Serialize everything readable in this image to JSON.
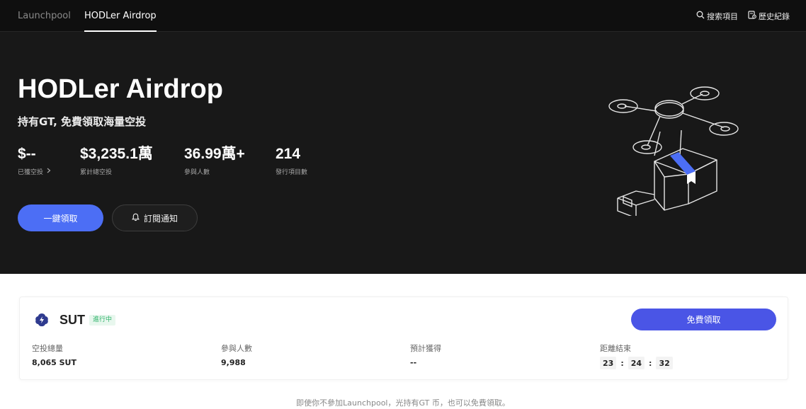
{
  "nav": {
    "tabs": [
      {
        "label": "Launchpool",
        "active": false
      },
      {
        "label": "HODLer Airdrop",
        "active": true
      }
    ],
    "search_label": "搜索項目",
    "history_label": "歷史紀錄",
    "search_icon": "search-icon",
    "history_icon": "history-icon"
  },
  "hero": {
    "title": "HODLer Airdrop",
    "subtitle": "持有GT, 免費領取海量空投",
    "stats": [
      {
        "value": "$--",
        "label": "已獲空投"
      },
      {
        "value": "$3,235.1萬",
        "label": "累計總空投"
      },
      {
        "value": "36.99萬+",
        "label": "參與人數"
      },
      {
        "value": "214",
        "label": "發行項目數"
      }
    ],
    "claim_all_label": "一鍵領取",
    "subscribe_label": "訂閱通知",
    "illustration_icon": "drone-package-illustration"
  },
  "project": {
    "token": "SUT",
    "status": "進行中",
    "claim_label": "免費領取",
    "fields": {
      "total_airdrop": {
        "label": "空投總量",
        "value": "8,065 SUT"
      },
      "participants": {
        "label": "參與人數",
        "value": "9,988"
      },
      "expected": {
        "label": "預計獲得",
        "value": "--"
      },
      "countdown": {
        "label": "距離結束",
        "hours": "23",
        "minutes": "24",
        "seconds": "32"
      }
    }
  },
  "footnote": "即使你不參加Launchpool，光持有GT 币，也可以免費領取。",
  "colors": {
    "accent": "#4c6ef5",
    "hero_bg": "#181818",
    "status_green": "#2fb36a",
    "claim_button": "#4a55e6"
  }
}
